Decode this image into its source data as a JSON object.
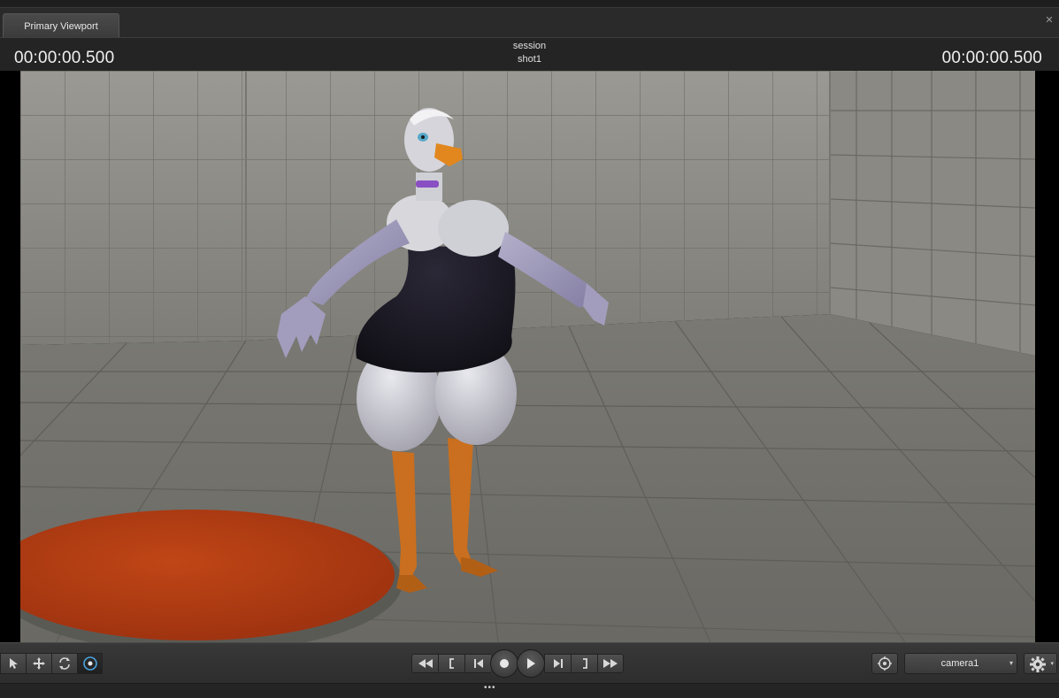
{
  "tab": {
    "label": "Primary Viewport",
    "close_glyph": "✕"
  },
  "header": {
    "timecode_left": "00:00:00.500",
    "timecode_right": "00:00:00.500",
    "session_label": "session",
    "shot_label": "shot1"
  },
  "viewport": {
    "floor_color": "#6f6e68",
    "wall_color": "#8c8b85",
    "rug_color": "#b23a13"
  },
  "tools": {
    "items": [
      {
        "name": "select-tool-icon",
        "active": false
      },
      {
        "name": "move-tool-icon",
        "active": false
      },
      {
        "name": "rotate-tool-icon",
        "active": false
      },
      {
        "name": "orbit-tool-icon",
        "active": true
      }
    ]
  },
  "transport": {
    "buttons": [
      "rewind-icon",
      "mark-in-icon",
      "step-back-icon",
      "record-icon",
      "play-icon",
      "step-forward-icon",
      "mark-out-icon",
      "fast-forward-icon"
    ]
  },
  "camera": {
    "selected": "camera1",
    "dropdown_glyph": "▾"
  },
  "settings": {
    "icon": "gear-icon",
    "dropdown_glyph": "▾"
  },
  "status": {
    "grip": "•••"
  },
  "colors": {
    "accent": "#4aa3df",
    "panel": "#2b2b2b"
  }
}
